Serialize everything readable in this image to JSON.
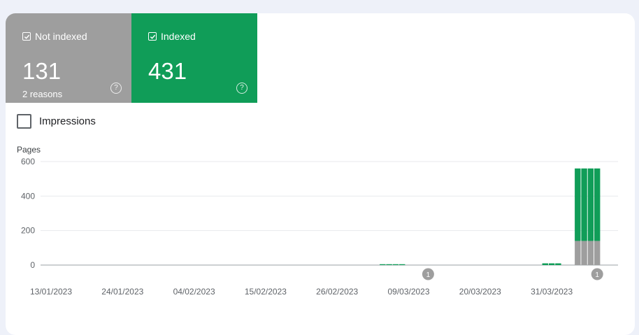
{
  "tiles": {
    "not_indexed": {
      "label": "Not indexed",
      "value": "131",
      "sub": "2 reasons",
      "help": "?"
    },
    "indexed": {
      "label": "Indexed",
      "value": "431",
      "help": "?"
    }
  },
  "impressions_label": "Impressions",
  "colors": {
    "indexed": "#109d58",
    "not_indexed": "#9e9e9e",
    "grid": "#e8eaed",
    "axis": "#9aa0a6"
  },
  "chart_data": {
    "type": "bar",
    "stacked": true,
    "ylabel": "Pages",
    "ylim": [
      0,
      600
    ],
    "yticks": [
      0,
      200,
      400,
      600
    ],
    "xticks": [
      "13/01/2023",
      "24/01/2023",
      "04/02/2023",
      "15/02/2023",
      "26/02/2023",
      "09/03/2023",
      "20/03/2023",
      "31/03/2023"
    ],
    "annotations": [
      {
        "date": "12/03/2023",
        "label": "1"
      },
      {
        "date": "07/04/2023",
        "label": "1"
      }
    ],
    "series": [
      {
        "name": "Not indexed",
        "color": "#9e9e9e",
        "values": [
          {
            "date": "05/03/2023",
            "value": 0
          },
          {
            "date": "06/03/2023",
            "value": 0
          },
          {
            "date": "07/03/2023",
            "value": 0
          },
          {
            "date": "08/03/2023",
            "value": 0
          },
          {
            "date": "30/03/2023",
            "value": 0
          },
          {
            "date": "31/03/2023",
            "value": 0
          },
          {
            "date": "01/04/2023",
            "value": 0
          },
          {
            "date": "04/04/2023",
            "value": 140
          },
          {
            "date": "05/04/2023",
            "value": 140
          },
          {
            "date": "06/04/2023",
            "value": 140
          },
          {
            "date": "07/04/2023",
            "value": 140
          }
        ]
      },
      {
        "name": "Indexed",
        "color": "#109d58",
        "values": [
          {
            "date": "05/03/2023",
            "value": 5
          },
          {
            "date": "06/03/2023",
            "value": 5
          },
          {
            "date": "07/03/2023",
            "value": 5
          },
          {
            "date": "08/03/2023",
            "value": 5
          },
          {
            "date": "30/03/2023",
            "value": 10
          },
          {
            "date": "31/03/2023",
            "value": 10
          },
          {
            "date": "01/04/2023",
            "value": 10
          },
          {
            "date": "04/04/2023",
            "value": 420
          },
          {
            "date": "05/04/2023",
            "value": 420
          },
          {
            "date": "06/04/2023",
            "value": 420
          },
          {
            "date": "07/04/2023",
            "value": 420
          }
        ]
      }
    ]
  }
}
